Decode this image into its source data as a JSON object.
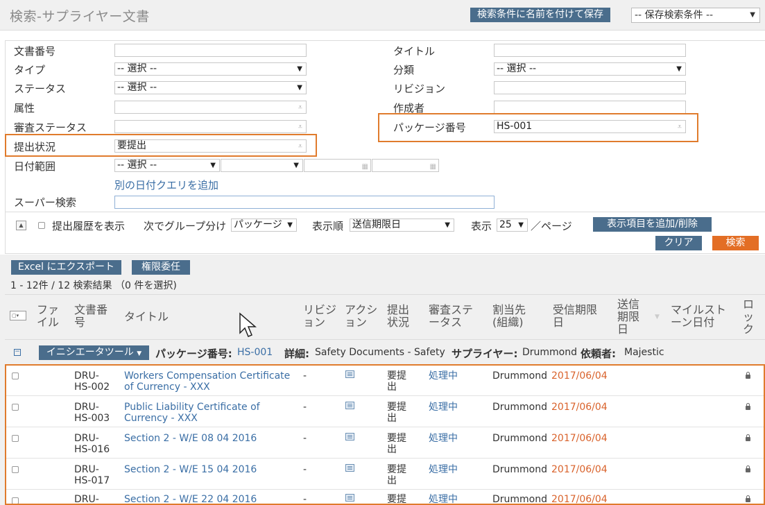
{
  "header": {
    "title": "検索-サプライヤー文書",
    "save_button": "検索条件に名前を付けて保存",
    "saved_select": "-- 保存検索条件 --"
  },
  "form": {
    "doc_number_label": "文書番号",
    "type_label": "タイプ",
    "type_value": "-- 選択 --",
    "status_label": "ステータス",
    "status_value": "-- 選択 --",
    "attribute_label": "属性",
    "review_status_label": "審査ステータス",
    "submission_label": "提出状況",
    "submission_value": "要提出",
    "date_range_label": "日付範囲",
    "date_range_value": "-- 選択 --",
    "add_date_query": "別の日付クエリを追加",
    "super_search_label": "スーパー検索",
    "title_label": "タイトル",
    "category_label": "分類",
    "category_value": "-- 選択 --",
    "revision_label": "リビジョン",
    "author_label": "作成者",
    "package_label": "パッケージ番号",
    "package_value": "HS-001"
  },
  "toolbar": {
    "show_history": "提出履歴を表示",
    "group_by_label": "次でグループ分け",
    "group_by_value": "パッケージ",
    "order_label": "表示順",
    "order_value": "送信期限日",
    "show_label": "表示",
    "show_value": "25",
    "per_page": "／ページ",
    "add_remove_columns": "表示項目を追加/削除",
    "clear": "クリア",
    "search": "検索"
  },
  "results": {
    "export_button": "Excel にエクスポート",
    "delegate_button": "権限委任",
    "count_text": "1 - 12件 / 12 検索結果 （0 件を選択)"
  },
  "columns": {
    "file": [
      "ファ",
      "イル"
    ],
    "doc_number": [
      "文書番",
      "号"
    ],
    "title": "タイトル",
    "revision": [
      "リビジ",
      "ョン"
    ],
    "action": [
      "アクシ",
      "ョン"
    ],
    "submission": [
      "提出",
      "状況"
    ],
    "review": [
      "審査ステ",
      "ータス"
    ],
    "assignee": [
      "割当先",
      "(組織)"
    ],
    "received": [
      "受信期限",
      "日"
    ],
    "due": [
      "送信",
      "期限",
      "日"
    ],
    "milestone": [
      "マイルスト",
      "ーン日付"
    ],
    "lock": [
      "ロ",
      "ッ",
      "ク"
    ]
  },
  "group": {
    "initiator_button": "イニシエータツール",
    "package_label": "パッケージ番号:",
    "package_value": "HS-001",
    "detail_label": "詳細:",
    "detail_value": "Safety Documents - Safety",
    "supplier_label": "サプライヤー:",
    "supplier_value": "Drummond",
    "requester_label": "依頼者:",
    "requester_value": "Majestic"
  },
  "rows": [
    {
      "doc1": "DRU-",
      "doc2": "HS-002",
      "title1": "Workers Compensation Certificate",
      "title2": "of Currency - XXX",
      "rev": "-",
      "sub1": "要提",
      "sub2": "出",
      "review": "処理中",
      "assignee": "Drummond",
      "date": "2017/06/04"
    },
    {
      "doc1": "DRU-",
      "doc2": "HS-003",
      "title1": "Public Liability Certificate of",
      "title2": "Currency - XXX",
      "rev": "-",
      "sub1": "要提",
      "sub2": "出",
      "review": "処理中",
      "assignee": "Drummond",
      "date": "2017/06/04"
    },
    {
      "doc1": "DRU-",
      "doc2": "HS-016",
      "title1": "Section 2 - W/E 08 04 2016",
      "title2": "",
      "rev": "-",
      "sub1": "要提",
      "sub2": "出",
      "review": "処理中",
      "assignee": "Drummond",
      "date": "2017/06/04"
    },
    {
      "doc1": "DRU-",
      "doc2": "HS-017",
      "title1": "Section 2 - W/E 15 04 2016",
      "title2": "",
      "rev": "-",
      "sub1": "要提",
      "sub2": "出",
      "review": "処理中",
      "assignee": "Drummond",
      "date": "2017/06/04"
    },
    {
      "doc1": "DRU-",
      "doc2": "",
      "title1": "Section 2 - W/E 22 04 2016",
      "title2": "",
      "rev": "-",
      "sub1": "要提",
      "sub2": "",
      "review": "処理中",
      "assignee": "Drummond",
      "date": "2017/06/04"
    }
  ],
  "colors": {
    "accent_blue": "#4a6d8c",
    "accent_orange": "#e36e25",
    "highlight": "#e07b2c",
    "link": "#3a6ea5"
  }
}
